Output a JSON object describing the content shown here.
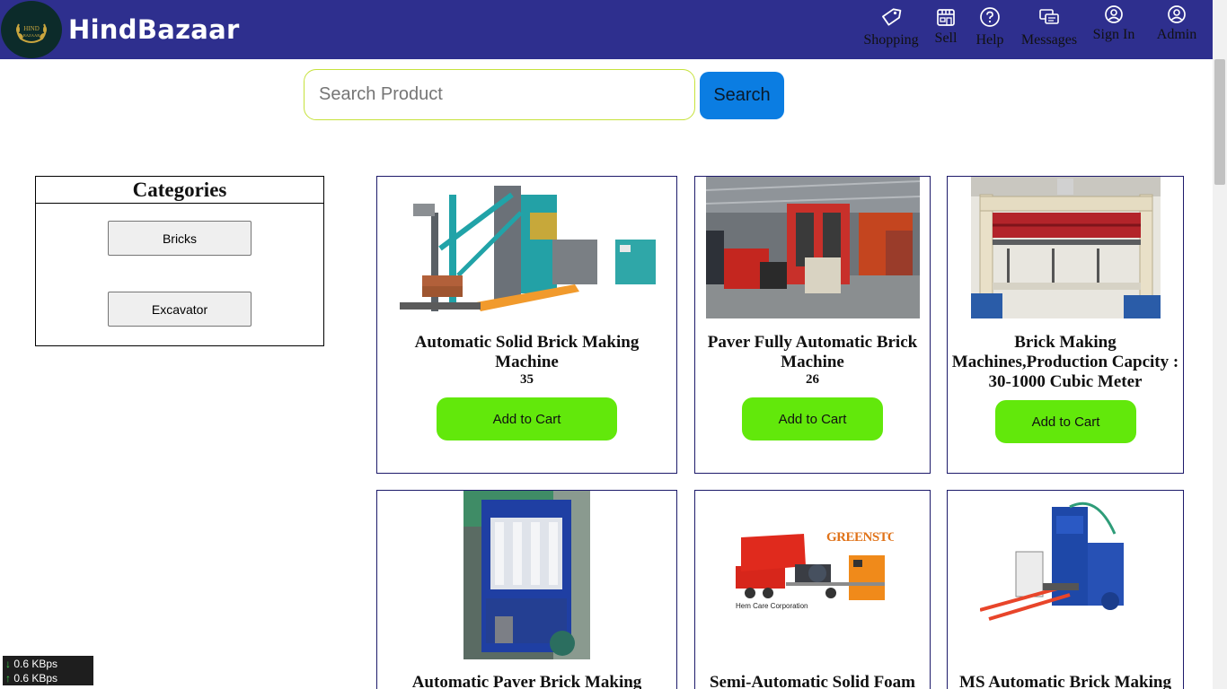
{
  "header": {
    "logo_text": "HIND BAZAAR",
    "brand": "HindBazaar",
    "nav": [
      {
        "label": "Shopping",
        "icon": "tag-icon"
      },
      {
        "label": "Sell",
        "icon": "store-icon"
      },
      {
        "label": "Help",
        "icon": "help-icon"
      },
      {
        "label": "Messages",
        "icon": "messages-icon"
      },
      {
        "label": "Sign In",
        "icon": "user-circle-icon"
      },
      {
        "label": "Admin",
        "icon": "user-circle-icon"
      }
    ]
  },
  "search": {
    "placeholder": "Search Product",
    "button_label": "Search"
  },
  "categories": {
    "title": "Categories",
    "items": [
      "Bricks",
      "Excavator"
    ]
  },
  "products": [
    {
      "title": "Automatic Solid Brick Making Machine",
      "qty": "35",
      "button": "Add to Cart",
      "image": "brick-machine-image"
    },
    {
      "title": "Paver Fully Automatic Brick Machine",
      "qty": "26",
      "button": "Add to Cart",
      "image": "paver-machine-image"
    },
    {
      "title": "Brick Making Machines,Production Capcity : 30-1000 Cubic Meter",
      "qty": "",
      "button": "Add to Cart",
      "image": "aac-machine-image"
    },
    {
      "title": "Automatic Paver Brick Making",
      "image": "blue-paver-machine-image"
    },
    {
      "title": "Semi-Automatic Solid Foam",
      "image": "foam-machine-image"
    },
    {
      "title": "MS Automatic Brick Making",
      "image": "ms-brick-machine-image"
    }
  ],
  "greenstone_text": "GREENSTONE",
  "hem_care_text": "Hem Care Corporation",
  "netmeter": {
    "down": "0.6 KBps",
    "up": "0.6 KBps"
  },
  "colors": {
    "header_bg": "#2e2f8e",
    "search_button": "#0b7de2",
    "add_to_cart": "#62e80b",
    "card_border": "#1d1a6a"
  }
}
